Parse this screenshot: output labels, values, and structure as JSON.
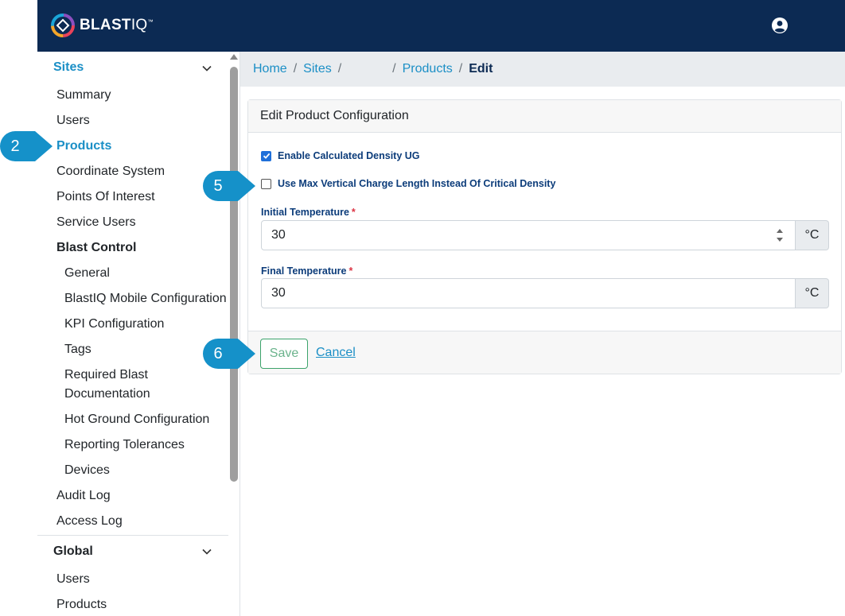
{
  "header": {
    "brand_main": "BLAST",
    "brand_suffix": "IQ",
    "brand_mark": "™",
    "logo_icon": "blastiq-logo-icon",
    "user_icon": "user-circle-icon"
  },
  "sidebar": {
    "sites_label": "Sites",
    "items": [
      {
        "label": "Summary"
      },
      {
        "label": "Users"
      },
      {
        "label": "Products"
      },
      {
        "label": "Coordinate System"
      },
      {
        "label": "Points Of Interest"
      },
      {
        "label": "Service Users"
      },
      {
        "label": "Blast Control"
      },
      {
        "label": "General"
      },
      {
        "label": "BlastIQ Mobile Configuration"
      },
      {
        "label": "KPI Configuration"
      },
      {
        "label": "Tags"
      },
      {
        "label": "Required Blast"
      },
      {
        "label": "Documentation"
      },
      {
        "label": "Hot Ground Configuration"
      },
      {
        "label": "Reporting Tolerances"
      },
      {
        "label": "Devices"
      },
      {
        "label": "Audit Log"
      },
      {
        "label": "Access Log"
      }
    ],
    "global_label": "Global",
    "global_items": [
      {
        "label": "Users"
      },
      {
        "label": "Products"
      }
    ]
  },
  "breadcrumb": {
    "home": "Home",
    "sites": "Sites",
    "products": "Products",
    "current": "Edit",
    "separator": "/"
  },
  "form": {
    "title": "Edit Product Configuration",
    "checkbox_density": {
      "label": "Enable Calculated Density UG",
      "checked": true
    },
    "checkbox_max_vertical": {
      "label": "Use Max Vertical Charge Length Instead Of Critical Density",
      "checked": false
    },
    "initial_temperature": {
      "label": "Initial Temperature",
      "required": "*",
      "value": "30",
      "unit": "°C"
    },
    "final_temperature": {
      "label": "Final Temperature",
      "required": "*",
      "value": "30",
      "unit": "°C"
    },
    "save_label": "Save",
    "cancel_label": "Cancel"
  },
  "callouts": [
    {
      "number": "2",
      "color": "#1591c9"
    },
    {
      "number": "5",
      "color": "#1591c9"
    },
    {
      "number": "6",
      "color": "#1591c9"
    }
  ],
  "colors": {
    "header_bg": "#0c2a53",
    "accent": "#1b8fc6",
    "label_blue": "#0c3c7a",
    "save_green": "#3ca36b"
  }
}
